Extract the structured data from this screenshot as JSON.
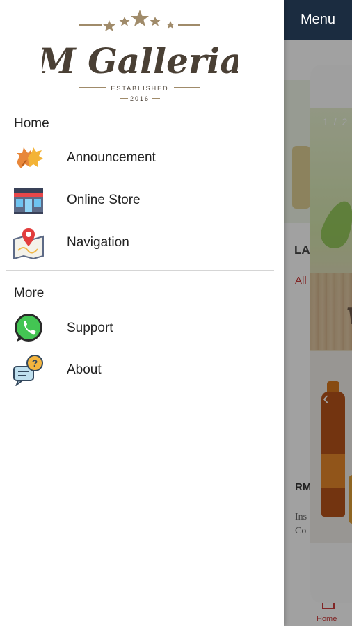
{
  "background": {
    "topbar_label": "Menu",
    "texts": {
      "la": "LA",
      "all": "All",
      "rm": "RM",
      "ins_line1": "Ins",
      "ins_line2": "Co"
    },
    "bottom_nav": {
      "home_label": "Home"
    },
    "popup": {
      "counter": "1 / 2",
      "prev_glyph": "‹",
      "banner_word": "w"
    }
  },
  "drawer": {
    "logo": {
      "name": "M Galleria",
      "tagline": "ESTABLISHED",
      "year": "2016"
    },
    "sections": [
      {
        "title": "Home",
        "items": [
          {
            "label": "Announcement",
            "icon": "maple-leaf-icon"
          },
          {
            "label": "Online Store",
            "icon": "storefront-icon"
          },
          {
            "label": "Navigation",
            "icon": "map-pin-icon"
          }
        ]
      },
      {
        "title": "More",
        "items": [
          {
            "label": "Support",
            "icon": "whatsapp-icon"
          },
          {
            "label": "About",
            "icon": "question-chat-icon"
          }
        ]
      }
    ]
  },
  "colors": {
    "topbar": "#1b2c40",
    "accent_red": "#c73a3a",
    "text": "#222222",
    "logo_brown": "#4a4035",
    "logo_gold": "#a08b6a"
  }
}
